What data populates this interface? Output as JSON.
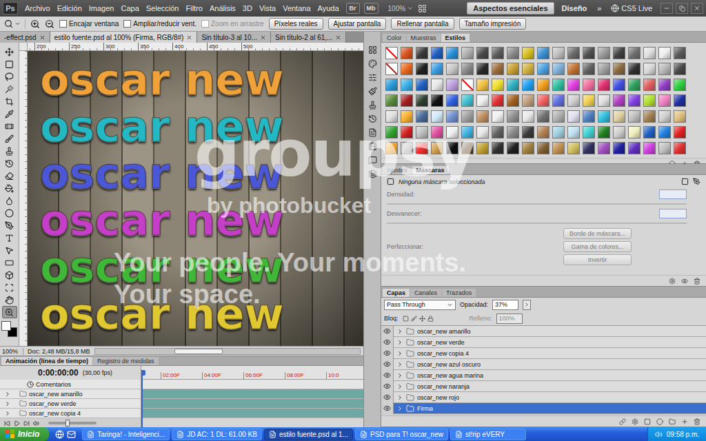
{
  "app_bar": {
    "logo": "Ps",
    "menus": [
      "Archivo",
      "Edición",
      "Imagen",
      "Capa",
      "Selección",
      "Filtro",
      "Análisis",
      "3D",
      "Vista",
      "Ventana",
      "Ayuda"
    ],
    "bridge": "Br",
    "mini_bridge": "Mb",
    "zoom": "100%",
    "workspaces": [
      {
        "label": "Aspectos esenciales",
        "selected": true
      },
      {
        "label": "Diseño",
        "selected": false
      }
    ],
    "more": "»",
    "cs_live": "CS5 Live"
  },
  "options_bar": {
    "checkboxes": [
      {
        "label": "Encajar ventana",
        "checked": false,
        "disabled": false
      },
      {
        "label": "Ampliar/reducir vent.",
        "checked": false,
        "disabled": false
      },
      {
        "label": "Zoom en arrastre",
        "checked": false,
        "disabled": true
      }
    ],
    "buttons": [
      "Píxeles reales",
      "Ajustar pantalla",
      "Rellenar pantalla",
      "Tamaño impresión"
    ]
  },
  "doc_tabs": [
    {
      "label": "-effect.psd",
      "selected": false
    },
    {
      "label": "estilo fuente.psd al 100% (Firma, RGB/8#)",
      "selected": true
    },
    {
      "label": "Sin título-3 al 10...",
      "selected": false
    },
    {
      "label": "Sin título-2 al 61,...",
      "selected": false
    }
  ],
  "tools": [
    {
      "selected": false
    },
    {
      "selected": false
    },
    {
      "selected": false
    },
    {
      "selected": false
    },
    {
      "selected": false
    },
    {
      "selected": false
    },
    {
      "selected": false
    },
    {
      "selected": false
    },
    {
      "selected": false
    },
    {
      "selected": false
    },
    {
      "selected": false
    },
    {
      "selected": false
    },
    {
      "selected": false
    },
    {
      "selected": false
    },
    {
      "selected": false
    },
    {
      "selected": false
    },
    {
      "selected": false
    },
    {
      "selected": false
    },
    {
      "selected": false
    },
    {
      "selected": false
    },
    {
      "selected": false
    },
    {
      "selected": true
    }
  ],
  "colors": {
    "foreground": "#ffffff",
    "background": "#000000"
  },
  "ruler": {
    "ticks": [
      "200",
      "250",
      "300",
      "350",
      "400",
      "450",
      "500"
    ]
  },
  "canvas": {
    "lines": [
      {
        "text": "oscar new",
        "color": "#f0a23a"
      },
      {
        "text": "oscar new",
        "color": "#23b8c4"
      },
      {
        "text": "oscar new",
        "color": "#4a58d8"
      },
      {
        "text": "oscar new",
        "color": "#c43fc8"
      },
      {
        "text": "oscar new",
        "color": "#3fb83a"
      },
      {
        "text": "oscar new",
        "color": "#e0c832"
      }
    ]
  },
  "status": {
    "zoom": "100%",
    "doc": "Doc: 2,48 MB/15,8 MB",
    "scroll_level": 0.3
  },
  "timeline": {
    "tabs": [
      {
        "label": "Animación (línea de tiempo)",
        "selected": true
      },
      {
        "label": "Registro de medidas",
        "selected": false
      }
    ],
    "time": "0:00:00:00",
    "fps": "(30,00 fps)",
    "ticks": [
      "02:00F",
      "04:00F",
      "06:00F",
      "08:00F",
      "10:0"
    ],
    "playhead_level": 0,
    "zoom_level": 0.35,
    "rows": [
      {
        "label": "Comentarios",
        "kind": "comments",
        "expanded": false
      },
      {
        "label": "oscar_new amarillo",
        "kind": "group",
        "expanded": false
      },
      {
        "label": "oscar_new verde",
        "kind": "group",
        "expanded": false
      },
      {
        "label": "oscar_new copia 4",
        "kind": "group",
        "expanded": false
      }
    ]
  },
  "styles_panel": {
    "tabs": [
      {
        "label": "Color",
        "selected": false
      },
      {
        "label": "Muestras",
        "selected": false
      },
      {
        "label": "Estilos",
        "selected": true
      }
    ],
    "swatches": [
      [
        "none",
        "#d9531e",
        "#3a3a3a",
        "#1f5fbf",
        "#2b8fd8",
        "#b0b0b0",
        "#4a4a4a",
        "#5c5c5c",
        "#8a8a8a",
        "#d8c020",
        "#3c8fd0",
        "#c0c0c0",
        "#6a6a6a",
        "#505050",
        "#9a9a9a",
        "#404040",
        "#707070",
        "#e0e0e0",
        "#f0f0f0",
        "#5a5a5a"
      ],
      [
        "none",
        "#e8661c",
        "#202020",
        "#3a9ae0",
        "#c8c8c8",
        "#888888",
        "#2a2a2a",
        "#9b6b3a",
        "#c8a030",
        "#d0b040",
        "#4aa0e0",
        "#7fb0d8",
        "#c07030",
        "#606060",
        "#a0a0a0",
        "#8a6a40",
        "#303030",
        "#d8d8d8",
        "#b8b8b8",
        "#484848"
      ],
      [
        "#2a9ad8",
        "#3ab0e8",
        "#2060c0",
        "#e8e8e8",
        "#c0a0e0",
        "none",
        "#f0c040",
        "#f0e030",
        "#30b0c0",
        "#20a0f0",
        "#f0a020",
        "#30c0a0",
        "#e040e0",
        "#f070a0",
        "#e03070",
        "#4050e0",
        "#30a060",
        "#e06060",
        "#9040c0",
        "#30d040"
      ],
      [
        "#5a8a3a",
        "#a02020",
        "#304030",
        "#101010",
        "#3060e0",
        "#40c0d0",
        "#f0f0f0",
        "#e03030",
        "#a06020",
        "#c0a080",
        "#f06060",
        "#6070e0",
        "#d0d0d0",
        "#f0d050",
        "#e0e0e0",
        "#b040c0",
        "#8040e0",
        "#b0e030",
        "#f080c0",
        "#2030a0"
      ],
      [
        "#e0e0e0",
        "#f8b030",
        "#4a6a9a",
        "#d0e8f8",
        "#7090d0",
        "#a0a0a0",
        "#c09060",
        "#f0f0f0",
        "#909090",
        "#e8e8e8",
        "#707070",
        "#b0b0b0",
        "#e0e0f0",
        "#5080c0",
        "#30c0e0",
        "#e0d0a0",
        "#c0c0c0",
        "#a08050",
        "#d0d0d0",
        "#e0c080"
      ],
      [
        "#30a030",
        "#d02020",
        "#c0c0c0",
        "#e050a0",
        "#f0f0f0",
        "#40b0e0",
        "#e8e8e8",
        "#606060",
        "#8a8a8a",
        "#3a3a3a",
        "#b08050",
        "#a0d0e0",
        "#c0e0f0",
        "#40d0d0",
        "#208020",
        "#d0d0d0",
        "#f0f0c0",
        "#2060c0",
        "#2080e0",
        "#e02020"
      ],
      [
        "#f0a020",
        "#b0b0b0",
        "#f03030",
        "#d0a050",
        "#101010",
        "#604020",
        "#c0a030",
        "#303030",
        "#202020",
        "#a08040",
        "#806030",
        "#c09050",
        "#d0c060",
        "#303060",
        "#a050c0",
        "#2020a0",
        "#6030c0",
        "#d040e0",
        "#c0c0c0",
        "#e03030"
      ]
    ]
  },
  "masks_panel": {
    "tabs": [
      {
        "label": "Ajustes",
        "selected": false
      },
      {
        "label": "Máscaras",
        "selected": true
      }
    ],
    "status": "Ninguna máscara seleccionada",
    "fields": [
      {
        "label": "Densidad:"
      },
      {
        "label": "Desvanecer:"
      }
    ],
    "refine": "Perfeccionar:",
    "buttons": [
      "Borde de máscara...",
      "Gama de colores...",
      "Invertir"
    ]
  },
  "layers_panel": {
    "tabs": [
      {
        "label": "Capas",
        "selected": true
      },
      {
        "label": "Canales",
        "selected": false
      },
      {
        "label": "Trazados",
        "selected": false
      }
    ],
    "blend_mode": "Pass Through",
    "opacity_label": "Opacidad:",
    "opacity": "37%",
    "lock_label": "Bloq:",
    "fill_label": "Relleno:",
    "fill": "100%",
    "layers": [
      {
        "name": "oscar_new amarillo",
        "visible": true,
        "expanded": false,
        "selected": false
      },
      {
        "name": "oscar_new verde",
        "visible": true,
        "expanded": false,
        "selected": false
      },
      {
        "name": "oscar_new copia 4",
        "visible": true,
        "expanded": false,
        "selected": false
      },
      {
        "name": "oscar_new azul oscuro",
        "visible": true,
        "expanded": false,
        "selected": false
      },
      {
        "name": "oscar_new agua marina",
        "visible": true,
        "expanded": false,
        "selected": false
      },
      {
        "name": "oscar_new naranja",
        "visible": true,
        "expanded": false,
        "selected": false
      },
      {
        "name": "oscar_new rojo",
        "visible": true,
        "expanded": false,
        "selected": false
      },
      {
        "name": "Firma",
        "visible": true,
        "expanded": false,
        "selected": true
      }
    ]
  },
  "taskbar": {
    "start": "Inicio",
    "items": [
      {
        "label": "Taringa! - Inteligenci...",
        "selected": false
      },
      {
        "label": "JD AC: 1 DL: 61.00 KB",
        "selected": false
      },
      {
        "label": "estilo fuente.psd al 1...",
        "selected": true
      },
      {
        "label": "PSD para T! oscar_new",
        "selected": false
      },
      {
        "label": "st!rip eVERY",
        "selected": false
      }
    ],
    "clock": "09:58 p.m."
  },
  "watermark": {
    "logo": "groupsy",
    "by": "by photobucket",
    "slogan": [
      "Your people. Your moments.",
      "Your space."
    ]
  }
}
